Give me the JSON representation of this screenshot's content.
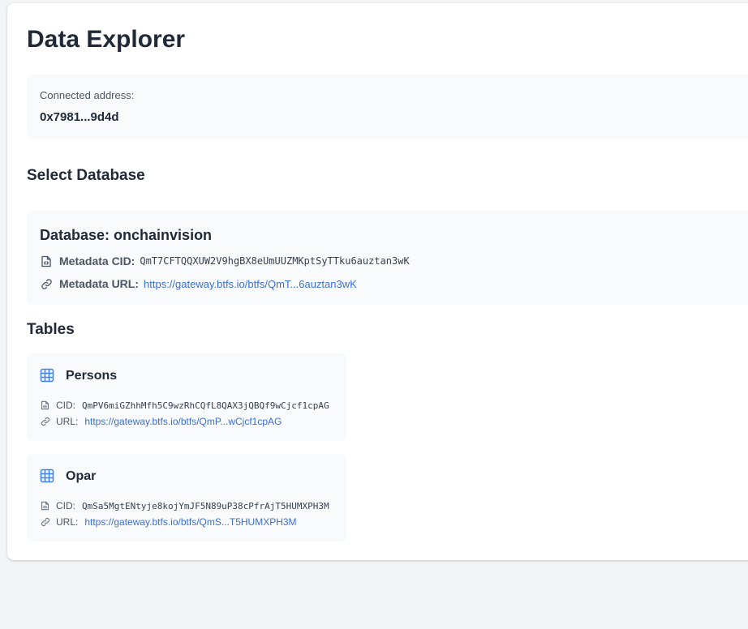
{
  "page": {
    "title": "Data Explorer"
  },
  "connection": {
    "label": "Connected address:",
    "address": "0x7981...9d4d"
  },
  "select_database": {
    "title": "Select Database"
  },
  "database": {
    "name": "Database: onchainvision",
    "metadata_cid_label": "Metadata CID:",
    "metadata_cid": "QmT7CFTQQXUW2V9hgBX8eUmUUZMKptSyTTku6auztan3wK",
    "metadata_url_label": "Metadata URL:",
    "metadata_url": "https://gateway.btfs.io/btfs/QmT...6auztan3wK",
    "cid_icon": "file-code-icon",
    "url_icon": "link-icon"
  },
  "tables": {
    "title": "Tables",
    "items": [
      {
        "name": "Persons",
        "icon": "table-icon",
        "cid_label": "CID:",
        "cid": "QmPV6miGZhhMfh5C9wzRhCQfL8QAX3jQBQf9wCjcf1cpAG",
        "url_label": "URL:",
        "url": "https://gateway.btfs.io/btfs/QmP...wCjcf1cpAG"
      },
      {
        "name": "Opar",
        "icon": "table-icon",
        "cid_label": "CID:",
        "cid": "QmSa5MgtENtyje8kojYmJF5N89uP38cPfrAjT5HUMXPH3M",
        "url_label": "URL:",
        "url": "https://gateway.btfs.io/btfs/QmS...T5HUMXPH3M"
      }
    ]
  },
  "colors": {
    "background": "#f3f4f6",
    "card": "#ffffff",
    "panel": "#f9fafb",
    "text": "#1f2937",
    "link": "#3b6fd6",
    "table_icon": "#3b82f6"
  }
}
